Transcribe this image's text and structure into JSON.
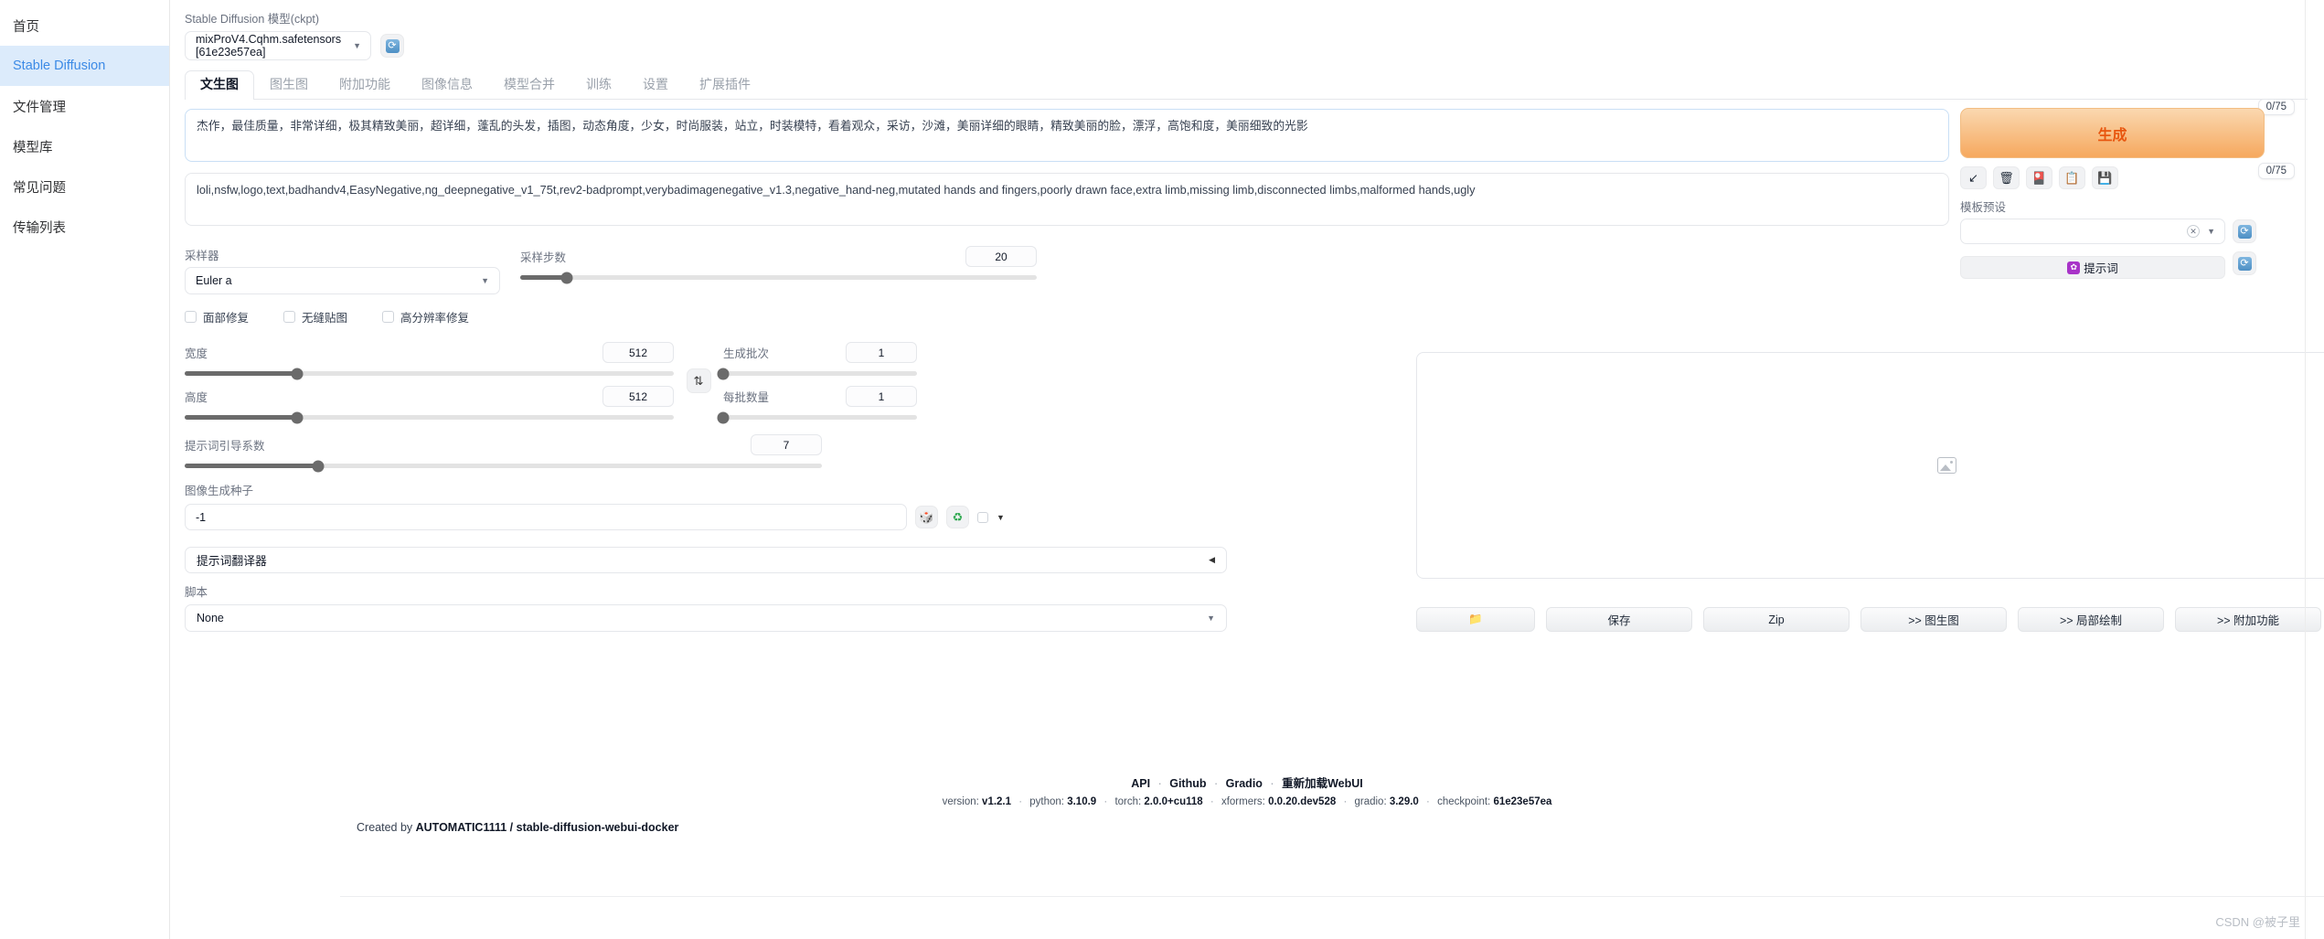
{
  "sidebar": {
    "items": [
      {
        "label": "首页",
        "name": "home",
        "active": false
      },
      {
        "label": "Stable Diffusion",
        "name": "stable-diffusion",
        "active": true
      },
      {
        "label": "文件管理",
        "name": "file-management",
        "active": false
      },
      {
        "label": "模型库",
        "name": "model-library",
        "active": false
      },
      {
        "label": "常见问题",
        "name": "faq",
        "active": false
      },
      {
        "label": "传输列表",
        "name": "transfer-list",
        "active": false
      }
    ]
  },
  "checkpoint": {
    "label": "Stable Diffusion 模型(ckpt)",
    "value": "mixProV4.Cqhm.safetensors [61e23e57ea]",
    "refresh_icon": "refresh-icon"
  },
  "tabs": [
    {
      "label": "文生图",
      "active": true
    },
    {
      "label": "图生图",
      "active": false
    },
    {
      "label": "附加功能",
      "active": false
    },
    {
      "label": "图像信息",
      "active": false
    },
    {
      "label": "模型合并",
      "active": false
    },
    {
      "label": "训练",
      "active": false
    },
    {
      "label": "设置",
      "active": false
    },
    {
      "label": "扩展插件",
      "active": false
    }
  ],
  "prompts": {
    "positive": "杰作，最佳质量，非常详细，极其精致美丽，超详细，蓬乱的头发，插图，动态角度，少女，时尚服装，站立，时装模特，看着观众，采访，沙滩，美丽详细的眼睛，精致美丽的脸，漂浮，高饱和度，美丽细致的光影",
    "positive_tokens": "0/75",
    "negative": "loli,nsfw,logo,text,badhandv4,EasyNegative,ng_deepnegative_v1_75t,rev2-badprompt,verybadimagenegative_v1.3,negative_hand-neg,mutated hands and fingers,poorly drawn face,extra limb,missing limb,disconnected limbs,malformed hands,ugly",
    "negative_tokens": "0/75"
  },
  "params": {
    "sampler_label": "采样器",
    "sampler_value": "Euler a",
    "steps_label": "采样步数",
    "steps_value": "20",
    "steps_pct": 9,
    "checkboxes": [
      {
        "label": "面部修复",
        "checked": false
      },
      {
        "label": "无缝贴图",
        "checked": false
      },
      {
        "label": "高分辨率修复",
        "checked": false
      }
    ],
    "width_label": "宽度",
    "width_value": "512",
    "width_pct": 23,
    "height_label": "高度",
    "height_value": "512",
    "height_pct": 23,
    "batch_count_label": "生成批次",
    "batch_count_value": "1",
    "batch_count_pct": 0,
    "batch_size_label": "每批数量",
    "batch_size_value": "1",
    "batch_size_pct": 0,
    "cfg_label": "提示词引导系数",
    "cfg_value": "7",
    "cfg_pct": 21,
    "seed_label": "图像生成种子",
    "seed_value": "-1",
    "swap_icon": "swap-arrows-icon",
    "dice_icon": "dice-icon",
    "recycle_icon": "recycle-icon",
    "extra_toggle_icon": "chevron-down-icon"
  },
  "translator": {
    "title": "提示词翻译器",
    "collapse_icon": "chevron-left-icon"
  },
  "script": {
    "label": "脚本",
    "value": "None"
  },
  "right": {
    "generate_label": "生成",
    "tools": [
      {
        "name": "arrow-down-left-icon",
        "glyph": "↙"
      },
      {
        "name": "trash-icon",
        "glyph": "🗑"
      },
      {
        "name": "card-icon",
        "glyph": "🎴"
      },
      {
        "name": "clipboard-icon",
        "glyph": "📋"
      },
      {
        "name": "save-disk-icon",
        "glyph": "💾"
      }
    ],
    "preset_label": "模板预设",
    "preset_value": "",
    "preset_clear_icon": "clear-x-icon",
    "preset_refresh_icon": "refresh-icon",
    "prompt_word_label": "提示词",
    "prompt_word_icon": "settings-badge-icon",
    "prompt_word_refresh_icon": "refresh-icon"
  },
  "gallery": {
    "placeholder_icon": "image-placeholder-icon"
  },
  "actions": [
    {
      "label": "",
      "name": "open-folder-button",
      "icon": "folder-icon"
    },
    {
      "label": "保存",
      "name": "save-button",
      "icon": ""
    },
    {
      "label": "Zip",
      "name": "zip-button",
      "icon": ""
    },
    {
      "label": ">> 图生图",
      "name": "send-to-img2img-button",
      "icon": ""
    },
    {
      "label": ">> 局部绘制",
      "name": "send-to-inpaint-button",
      "icon": ""
    },
    {
      "label": ">> 附加功能",
      "name": "send-to-extras-button",
      "icon": ""
    }
  ],
  "footer": {
    "links": [
      "API",
      "Github",
      "Gradio",
      "重新加载WebUI"
    ],
    "separator": "·",
    "version_parts": [
      {
        "key": "version: ",
        "val": "v1.2.1"
      },
      {
        "key": "python: ",
        "val": "3.10.9"
      },
      {
        "key": "torch: ",
        "val": "2.0.0+cu118"
      },
      {
        "key": "xformers: ",
        "val": "0.0.20.dev528"
      },
      {
        "key": "gradio: ",
        "val": "3.29.0"
      },
      {
        "key": "checkpoint: ",
        "val": "61e23e57ea"
      }
    ],
    "created_prefix": "Created by ",
    "created_value": "AUTOMATIC1111 / stable-diffusion-webui-docker",
    "watermark": "CSDN @被子里"
  }
}
